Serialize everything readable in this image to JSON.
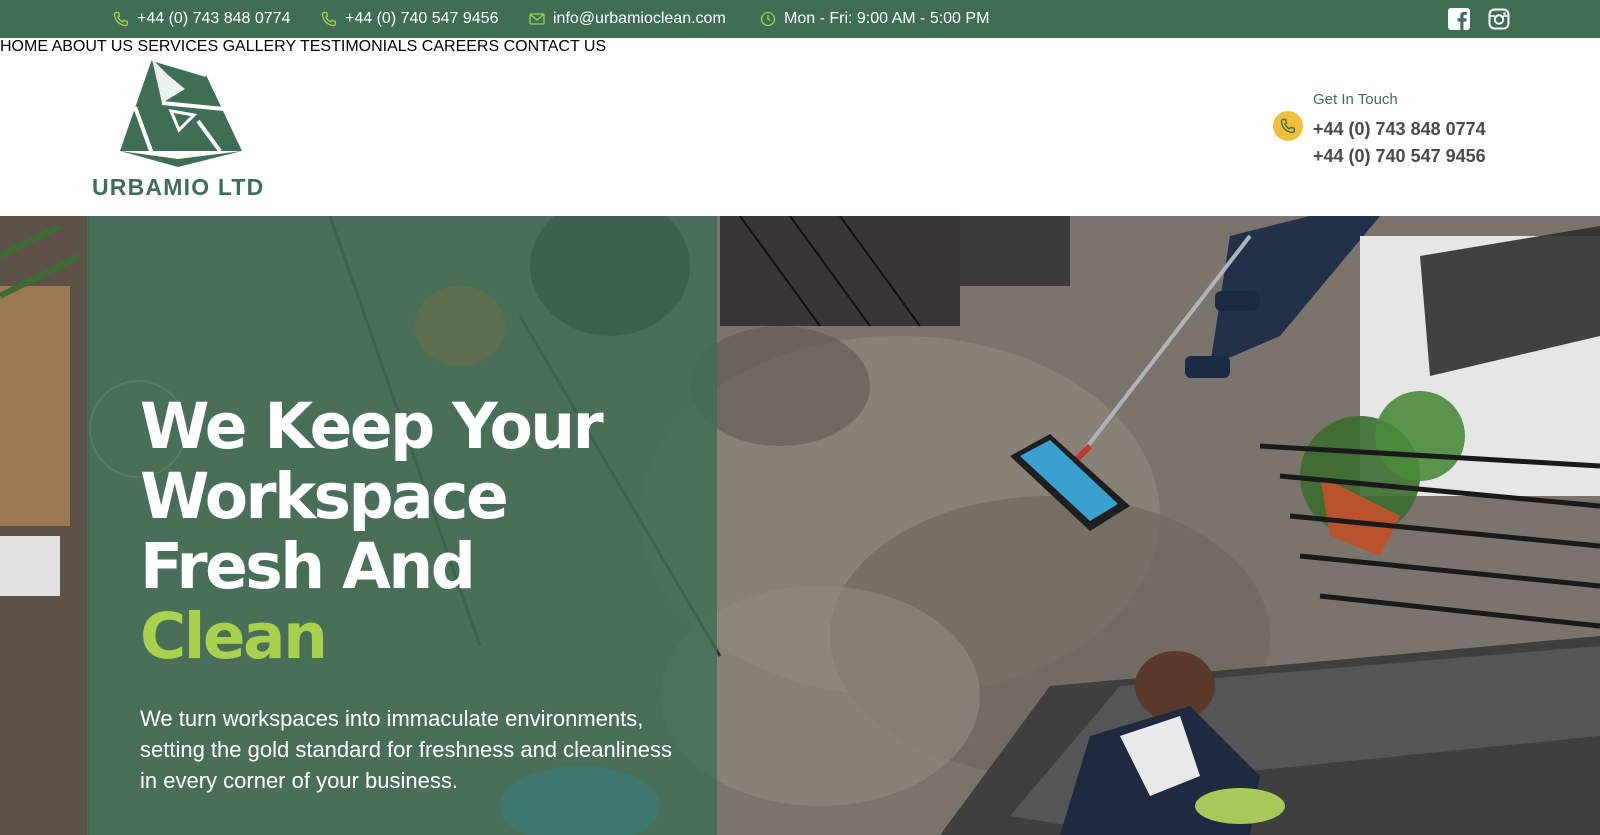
{
  "topbar": {
    "phone1": "+44 (0) 743 848 0774",
    "phone2": "+44 (0) 740 547 9456",
    "email": "info@urbamioclean.com",
    "hours": "Mon - Fri: 9:00 AM - 5:00 PM",
    "icons": {
      "phone": "phone-icon",
      "email": "mail-icon",
      "hours": "clock-icon",
      "facebook": "facebook-icon",
      "instagram": "instagram-icon"
    }
  },
  "header": {
    "logo_text": "URBAMIO LTD",
    "nav": [
      "HOME",
      "ABOUT US",
      "SERVICES",
      "GALLERY",
      "TESTIMONIALS",
      "CAREERS",
      "CONTACT US"
    ],
    "get_in_touch": "Get In Touch",
    "phone1": "+44 (0) 743 848 0774",
    "phone2": "+44 (0) 740 547 9456"
  },
  "hero": {
    "line1": "We Keep Your",
    "line2": "Workspace",
    "line3": "Fresh And",
    "accent": "Clean",
    "subtext": "We turn workspaces into immaculate environments, setting the gold standard for freshness and cleanliness in every corner of your business."
  },
  "colors": {
    "brand_green": "#3f6e55",
    "accent_lime": "#a8d14e",
    "accent_yellow": "#f0c03c"
  }
}
